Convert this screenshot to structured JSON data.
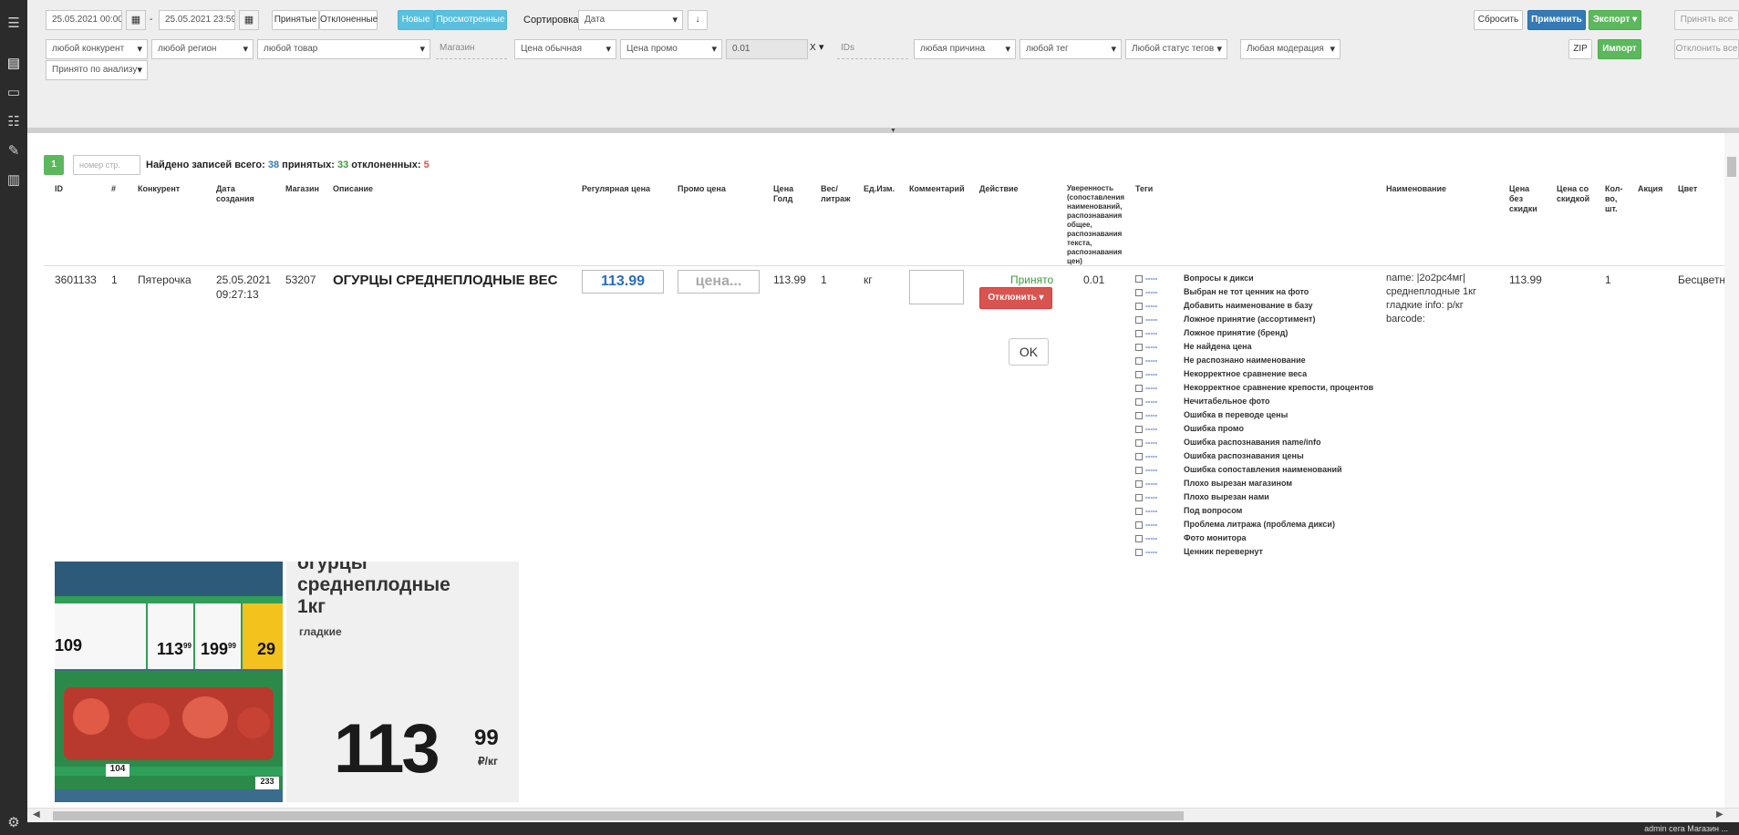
{
  "filters": {
    "date_from": "25.05.2021 00:00",
    "date_sep": "-",
    "date_to": "25.05.2021 23:59",
    "status_accepted": "Принятые",
    "status_rejected": "Отклоненные",
    "type_new": "Новые",
    "type_viewed": "Просмотренные",
    "sort_label": "Сортировка",
    "sort_value": "Дата",
    "btn_reset": "Сбросить",
    "btn_apply": "Применить",
    "btn_export": "Экспорт ▾",
    "btn_accept_all": "Принять все",
    "competitor": "любой конкурент",
    "region": "любой регион",
    "product": "любой товар",
    "store_placeholder": "Магазин",
    "price_regular": "Цена обычная",
    "price_promo": "Цена промо",
    "confidence_value": "0.01",
    "clear_x": "X",
    "ids_placeholder": "IDs",
    "reason": "любая причина",
    "tag": "любой тег",
    "tag_status": "Любой статус тегов",
    "moderation": "Любая модерация",
    "btn_zip": "ZIP",
    "btn_import": "Импорт",
    "btn_reject_all": "Отклонить все",
    "analysis": "Принято по анализу"
  },
  "summary": {
    "page": "1",
    "page_input_placeholder": "номер стр.",
    "found_label": "Найдено записей всего:",
    "found_total": "38",
    "accepted_label": "принятых:",
    "accepted_count": "33",
    "rejected_label": "отклоненных:",
    "rejected_count": "5"
  },
  "columns": {
    "id": "ID",
    "num": "#",
    "competitor": "Конкурент",
    "created": "Дата создания",
    "store": "Магазин",
    "description": "Описание",
    "regular_price": "Регулярная цена",
    "promo_price": "Промо цена",
    "gold_price": "Цена Голд",
    "weight": "Вес/ литраж",
    "unit": "Ед.Изм.",
    "comment": "Комментарий",
    "action": "Действие",
    "confidence": "Уверенность (сопоставления наименований, распознавания общее, распознавания текста, распознавания цен)",
    "tags": "Теги",
    "name": "Наименование",
    "price_no_discount": "Цена без скидки",
    "price_discount": "Цена со скидкой",
    "qty": "Кол-во, шт.",
    "promo": "Акция",
    "color": "Цвет"
  },
  "row": {
    "id": "3601133",
    "num": "1",
    "competitor": "Пятерочка",
    "created_date": "25.05.2021",
    "created_time": "09:27:13",
    "store": "53207",
    "description": "ОГУРЦЫ СРЕДНЕПЛОДНЫЕ ВЕС",
    "regular_price": "113.99",
    "promo_placeholder": "цена...",
    "gold_price": "113.99",
    "weight": "1",
    "unit": "кг",
    "status": "Принято",
    "reject_btn": "Отклонить ▾",
    "ok_btn": "OK",
    "confidence": "0.01",
    "name_lines": [
      "name: |2о2рс4мг|",
      "среднеплодные 1кг",
      "гладкие info: р/кг",
      "barcode:"
    ],
    "price_no_discount": "113.99",
    "qty": "1",
    "color": "Бесцветн"
  },
  "tags": [
    "Вопросы к дикси",
    "Выбран не тот ценник на фото",
    "Добавить наименование в базу",
    "Ложное принятие (ассортимент)",
    "Ложное принятие (бренд)",
    "Не найдена цена",
    "Не распознано наименование",
    "Некорректное сравнение веса",
    "Некорректное сравнение крепости, процентов",
    "Нечитабельное фото",
    "Ошибка в переводе цены",
    "Ошибка промо",
    "Ошибка распознавания name/info",
    "Ошибка распознавания цены",
    "Ошибка сопоставления наименований",
    "Плохо вырезан магазином",
    "Плохо вырезан нами",
    "Под вопросом",
    "Проблема литража (проблема дикси)",
    "Фото монитора",
    "Ценник перевернут"
  ],
  "tag_dash": "-----",
  "photo": {
    "shelf_prices": [
      "109",
      "113",
      "199",
      "29",
      "104",
      "233"
    ],
    "shelf_cents": [
      "99",
      "99"
    ],
    "label_title": "огурцы среднеплодные 1кг",
    "label_sub": "гладкие",
    "label_price": "113",
    "label_cents": "99",
    "label_unit": "₽/кг"
  },
  "status_bar": "admin   сега   Магазин   ..."
}
